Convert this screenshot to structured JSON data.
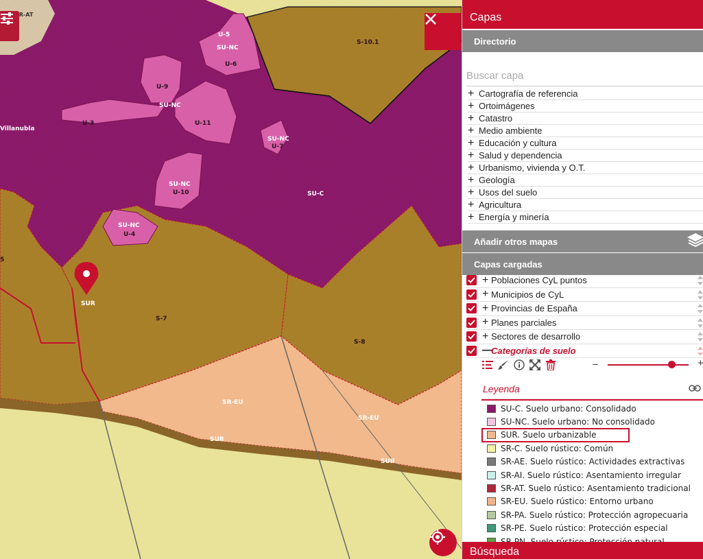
{
  "map": {
    "labels": {
      "sr_at": "SR-AT",
      "s10_1": "S-10.1",
      "u5": "U-5",
      "sunc": "SU-NC",
      "u6": "U-6",
      "u9": "U-9",
      "u3": "U-3",
      "u11": "U-11",
      "villanubla": "Villanubla",
      "u7": "U-7",
      "u10": "U-10",
      "suc": "SU-C",
      "u4": "U-4",
      "sur": "SUR",
      "s7": "S-7",
      "s8": "S-8",
      "sreu": "SR-EU",
      "s5": "5"
    },
    "colors": {
      "su_c": "#8c1a6a",
      "su_nc": "#d860a8",
      "sur": "#a9802a",
      "sr_eu": "#f1b98c",
      "sr_c": "#e9e39a",
      "accent": "#c8102e"
    }
  },
  "panel": {
    "title": "Capas",
    "directorio": "Directorio",
    "search_placeholder": "Buscar capa",
    "categories": [
      "Cartografía de referencia",
      "Ortoimágenes",
      "Catastro",
      "Medio ambiente",
      "Educación y cultura",
      "Salud y dependencia",
      "Urbanismo, vivienda y O.T.",
      "Geología",
      "Usos del suelo",
      "Agricultura",
      "Energía y minería"
    ],
    "add_maps": "Añadir otros mapas",
    "loaded_title": "Capas cargadas",
    "loaded_layers": [
      {
        "label": "Poblaciones CyL puntos",
        "checked": true
      },
      {
        "label": "Municipios de CyL",
        "checked": true
      },
      {
        "label": "Provincias de España",
        "checked": true
      },
      {
        "label": "Planes parciales",
        "checked": true
      },
      {
        "label": "Sectores de desarrollo",
        "checked": true
      },
      {
        "label": "Categorías de suelo",
        "checked": true
      }
    ],
    "opacity": 0.79,
    "legend_title": "Leyenda",
    "legend_items": [
      {
        "label": "SU-C. Suelo urbano: Consolidado",
        "color": "#8c1a6a"
      },
      {
        "label": "SU-NC. Suelo urbano: No consolidado",
        "color": "#f3c6e0"
      },
      {
        "label": "SUR. Suelo urbanizable",
        "color": "#f1b98c"
      },
      {
        "label": "SR-C. Suelo rústico: Común",
        "color": "#f6f0a8"
      },
      {
        "label": "SR-AE. Suelo rústico: Actividades extractivas",
        "color": "#7a7a7a"
      },
      {
        "label": "SR-AI. Suelo rústico: Asentamiento irregular",
        "color": "#c9f1ea"
      },
      {
        "label": "SR-AT. Suelo rústico: Asentamiento tradicional",
        "color": "#b0263a"
      },
      {
        "label": "SR-EU. Suelo rústico: Entorno urbano",
        "color": "#f2b48a"
      },
      {
        "label": "SR-PA. Suelo rústico: Protección agropecuaria",
        "color": "#b5c9a0"
      },
      {
        "label": "SR-PE. Suelo rústico: Protección especial",
        "color": "#3c9a78"
      },
      {
        "label": "SR-PN. Suelo rústico: Protección natural",
        "color": "#5ea04a"
      }
    ],
    "busqueda": "Búsqueda"
  }
}
